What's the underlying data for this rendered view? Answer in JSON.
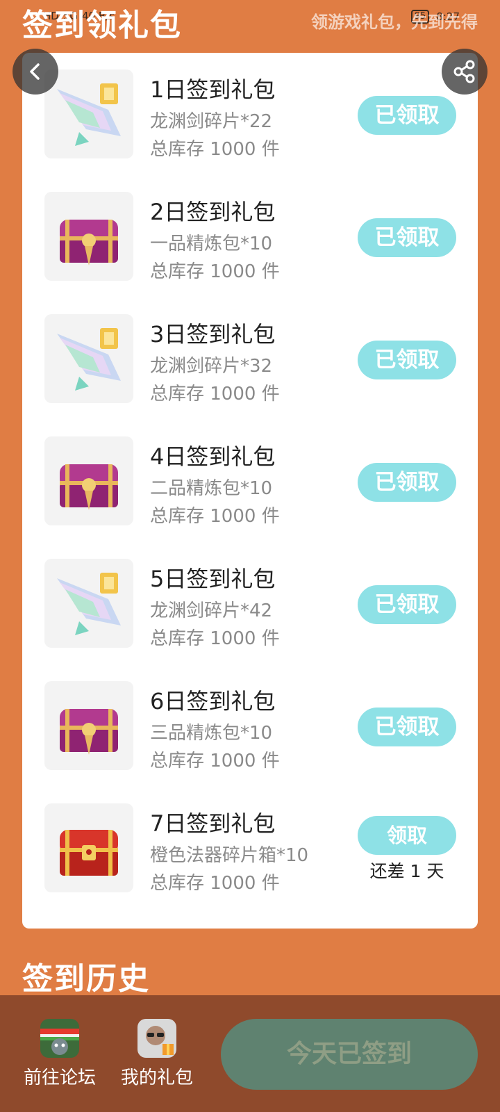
{
  "status_bar": {
    "left": [
      "HD",
      "5G",
      "40 B/s"
    ],
    "right": [
      "95",
      "8:27"
    ]
  },
  "header": {
    "title": "签到领礼包",
    "subtitle": "领游戏礼包，先到先得"
  },
  "gifts": [
    {
      "title": "1日签到礼包",
      "desc": "龙渊剑碎片*22",
      "stock": "总库存 1000 件",
      "button": "已领取",
      "icon": "sword-shard-icon"
    },
    {
      "title": "2日签到礼包",
      "desc": "一品精炼包*10",
      "stock": "总库存 1000 件",
      "button": "已领取",
      "icon": "purple-chest-icon"
    },
    {
      "title": "3日签到礼包",
      "desc": "龙渊剑碎片*32",
      "stock": "总库存 1000 件",
      "button": "已领取",
      "icon": "sword-shard-icon"
    },
    {
      "title": "4日签到礼包",
      "desc": "二品精炼包*10",
      "stock": "总库存 1000 件",
      "button": "已领取",
      "icon": "purple-chest-icon"
    },
    {
      "title": "5日签到礼包",
      "desc": "龙渊剑碎片*42",
      "stock": "总库存 1000 件",
      "button": "已领取",
      "icon": "sword-shard-icon"
    },
    {
      "title": "6日签到礼包",
      "desc": "三品精炼包*10",
      "stock": "总库存 1000 件",
      "button": "已领取",
      "icon": "purple-chest-icon"
    },
    {
      "title": "7日签到礼包",
      "desc": "橙色法器碎片箱*10",
      "stock": "总库存 1000 件",
      "button": "领取",
      "icon": "red-chest-icon",
      "remaining": "还差 1 天"
    }
  ],
  "history": {
    "title": "签到历史"
  },
  "bottom_bar": {
    "forum_label": "前往论坛",
    "my_gifts_label": "我的礼包",
    "checkin_label": "今天已签到"
  },
  "colors": {
    "background": "#e07d44",
    "claim_button": "#8ee1e6",
    "bottom_bar": "#8f4a2c",
    "checked_button": "#5f8270"
  }
}
